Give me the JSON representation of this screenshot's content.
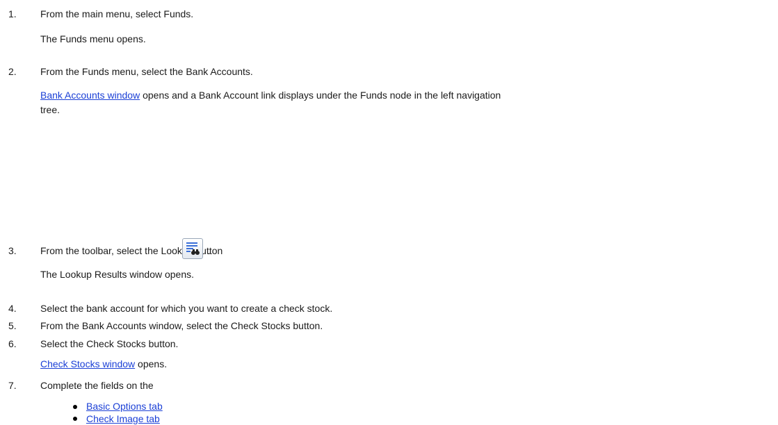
{
  "steps": [
    {
      "num": "1.",
      "text": "From the main menu, select Funds.",
      "result": "The Funds menu opens."
    },
    {
      "num": "2.",
      "text": "From the Funds menu, select the Bank Accounts.",
      "result_prefix": "",
      "result_link": "Bank Accounts window",
      "result_suffix": " opens and a Bank Account link displays under the Funds node in the left navigation",
      "result_wrap": "tree."
    },
    {
      "num": "3.",
      "text": "From the toolbar, select the Lookup button",
      "text_after": ".",
      "result": "The Lookup Results window opens."
    },
    {
      "num": "4.",
      "text": "Select the bank account for which you want to create a check stock."
    },
    {
      "num": "5.",
      "text": "From the Bank Accounts window, select the Check Stocks button."
    },
    {
      "num": "6.",
      "text": "Select the Check Stocks button.",
      "result_link": "Check Stocks window",
      "result_suffix": " opens."
    },
    {
      "num": "7.",
      "text": "Complete the fields on the"
    }
  ],
  "tabs": [
    {
      "label": "Basic Options tab"
    },
    {
      "label": "Check Image tab"
    }
  ],
  "icons": {
    "lookup": "binoculars-list-icon",
    "bullet": "bullet-dot"
  },
  "colors": {
    "link": "#1a3fd6",
    "text": "#1a1a1a"
  }
}
